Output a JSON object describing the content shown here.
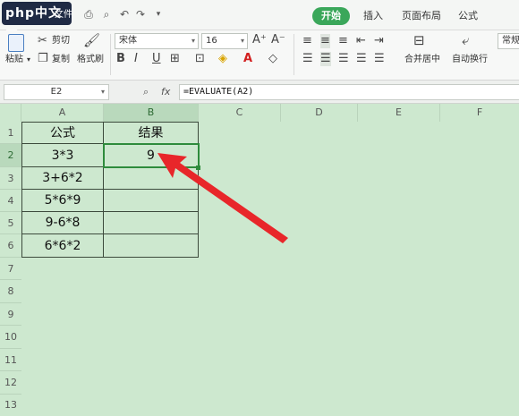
{
  "menubar": {
    "logo_text": "php中文网",
    "file_label": "文件",
    "tabs": [
      "开始",
      "插入",
      "页面布局",
      "公式"
    ]
  },
  "ribbon": {
    "paste_label": "粘贴",
    "cut_label": "剪切",
    "copy_label": "复制",
    "format_painter_label": "格式刷",
    "font_name": "宋体",
    "font_size": "16",
    "bold": "B",
    "italic": "I",
    "underline": "U",
    "merge_label": "合并居中",
    "wrap_label": "自动换行",
    "number_format": "常规"
  },
  "formulabar": {
    "name_box": "E2",
    "fx_label": "fx",
    "formula": "=EVALUATE(A2)"
  },
  "sheet": {
    "columns": [
      "A",
      "B",
      "C",
      "D",
      "E",
      "F"
    ],
    "rows": [
      "1",
      "2",
      "3",
      "4",
      "5",
      "6",
      "7",
      "8",
      "9",
      "10",
      "11",
      "12",
      "13"
    ],
    "headers": [
      "公式",
      "结果"
    ],
    "col_a": [
      "3*3",
      "3+6*2",
      "5*6*9",
      "9-6*8",
      "6*6*2"
    ],
    "col_b": [
      "9",
      "",
      "",
      "",
      ""
    ],
    "selected_cell": "B2"
  },
  "colors": {
    "accent": "#3aa75a",
    "sheet_bg": "#cde8cf",
    "arrow": "#e8262a"
  }
}
